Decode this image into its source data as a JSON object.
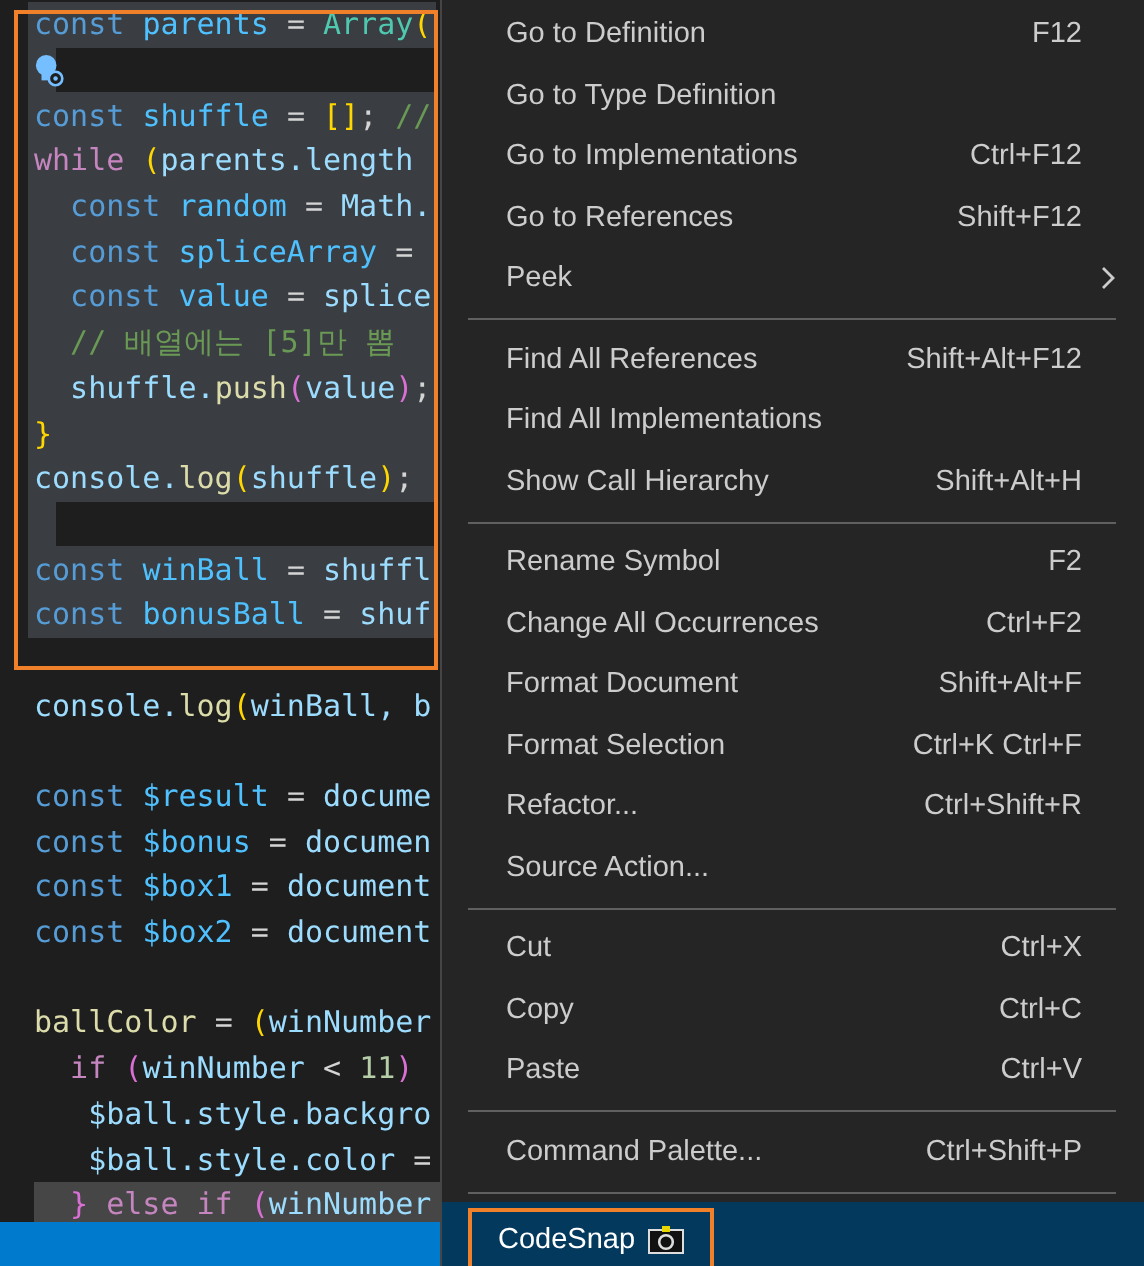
{
  "editor": {
    "outlined": true,
    "lines": [
      {
        "selected": true,
        "tokens": [
          {
            "kind": "kw",
            "text": "const "
          },
          {
            "kind": "const",
            "text": "parents "
          },
          {
            "kind": "op",
            "text": "= "
          },
          {
            "kind": "type",
            "text": "Array"
          },
          {
            "kind": "b1",
            "text": "("
          }
        ]
      },
      {
        "selected": true,
        "lightbulb": true
      },
      {
        "selected": true,
        "tokens": [
          {
            "kind": "kw",
            "text": "const "
          },
          {
            "kind": "const",
            "text": "shuffle "
          },
          {
            "kind": "op",
            "text": "= "
          },
          {
            "kind": "b1",
            "text": "[]"
          },
          {
            "kind": "op",
            "text": "; "
          },
          {
            "kind": "comment",
            "text": "//"
          }
        ]
      },
      {
        "selected": true,
        "tokens": [
          {
            "kind": "ctrl",
            "text": "while "
          },
          {
            "kind": "b1",
            "text": "("
          },
          {
            "kind": "var",
            "text": "parents.length"
          }
        ]
      },
      {
        "selected": true,
        "tokens": [
          {
            "kind": "kw",
            "text": "  const "
          },
          {
            "kind": "const",
            "text": "random "
          },
          {
            "kind": "op",
            "text": "= "
          },
          {
            "kind": "var",
            "text": "Math."
          }
        ]
      },
      {
        "selected": true,
        "tokens": [
          {
            "kind": "kw",
            "text": "  const "
          },
          {
            "kind": "const",
            "text": "spliceArray "
          },
          {
            "kind": "op",
            "text": "="
          }
        ]
      },
      {
        "selected": true,
        "tokens": [
          {
            "kind": "kw",
            "text": "  const "
          },
          {
            "kind": "const",
            "text": "value "
          },
          {
            "kind": "op",
            "text": "= "
          },
          {
            "kind": "var",
            "text": "splice"
          }
        ]
      },
      {
        "selected": true,
        "tokens": [
          {
            "kind": "comment",
            "text": "  // 배열에는 [5]만 뽑"
          }
        ]
      },
      {
        "selected": true,
        "tokens": [
          {
            "kind": "var",
            "text": "  shuffle."
          },
          {
            "kind": "func",
            "text": "push"
          },
          {
            "kind": "b2",
            "text": "("
          },
          {
            "kind": "var",
            "text": "value"
          },
          {
            "kind": "b2",
            "text": ")"
          },
          {
            "kind": "op",
            "text": ";"
          }
        ]
      },
      {
        "selected": true,
        "tokens": [
          {
            "kind": "b1",
            "text": "}"
          }
        ]
      },
      {
        "selected": true,
        "tokens": [
          {
            "kind": "var",
            "text": "console."
          },
          {
            "kind": "func",
            "text": "log"
          },
          {
            "kind": "b1",
            "text": "("
          },
          {
            "kind": "var",
            "text": "shuffle"
          },
          {
            "kind": "b1",
            "text": ")"
          },
          {
            "kind": "op",
            "text": ";"
          }
        ]
      },
      {
        "selected": true
      },
      {
        "selected": true,
        "tokens": [
          {
            "kind": "kw",
            "text": "const "
          },
          {
            "kind": "const",
            "text": "winBall "
          },
          {
            "kind": "op",
            "text": "= "
          },
          {
            "kind": "var",
            "text": "shuffl"
          }
        ]
      },
      {
        "selected": true,
        "tokens": [
          {
            "kind": "kw",
            "text": "const "
          },
          {
            "kind": "const",
            "text": "bonusBall "
          },
          {
            "kind": "op",
            "text": "= "
          },
          {
            "kind": "var",
            "text": "shuf"
          }
        ]
      },
      {
        "selected": false
      },
      {
        "selected": false,
        "tokens": [
          {
            "kind": "var",
            "text": "console."
          },
          {
            "kind": "func",
            "text": "log"
          },
          {
            "kind": "b1",
            "text": "("
          },
          {
            "kind": "var",
            "text": "winBall, b"
          }
        ]
      },
      {
        "selected": false
      },
      {
        "selected": false,
        "tokens": [
          {
            "kind": "kw",
            "text": "const "
          },
          {
            "kind": "const",
            "text": "$result "
          },
          {
            "kind": "op",
            "text": "= "
          },
          {
            "kind": "var",
            "text": "docume"
          }
        ]
      },
      {
        "selected": false,
        "tokens": [
          {
            "kind": "kw",
            "text": "const "
          },
          {
            "kind": "const",
            "text": "$bonus "
          },
          {
            "kind": "op",
            "text": "= "
          },
          {
            "kind": "var",
            "text": "documen"
          }
        ]
      },
      {
        "selected": false,
        "tokens": [
          {
            "kind": "kw",
            "text": "const "
          },
          {
            "kind": "const",
            "text": "$box1 "
          },
          {
            "kind": "op",
            "text": "= "
          },
          {
            "kind": "var",
            "text": "document"
          }
        ]
      },
      {
        "selected": false,
        "tokens": [
          {
            "kind": "kw",
            "text": "const "
          },
          {
            "kind": "const",
            "text": "$box2 "
          },
          {
            "kind": "op",
            "text": "= "
          },
          {
            "kind": "var",
            "text": "document"
          }
        ]
      },
      {
        "selected": false
      },
      {
        "selected": false,
        "tokens": [
          {
            "kind": "func",
            "text": "ballColor "
          },
          {
            "kind": "op",
            "text": "= "
          },
          {
            "kind": "b1",
            "text": "("
          },
          {
            "kind": "var",
            "text": "winNumber"
          }
        ]
      },
      {
        "selected": false,
        "tokens": [
          {
            "kind": "ctrl",
            "text": "  if "
          },
          {
            "kind": "b2",
            "text": "("
          },
          {
            "kind": "var",
            "text": "winNumber "
          },
          {
            "kind": "op",
            "text": "< "
          },
          {
            "kind": "num",
            "text": "11"
          },
          {
            "kind": "b2",
            "text": ")"
          }
        ]
      },
      {
        "selected": false,
        "tokens": [
          {
            "kind": "var",
            "text": "   $ball.style.backgro"
          }
        ]
      },
      {
        "selected": false,
        "tokens": [
          {
            "kind": "var",
            "text": "   $ball.style.color "
          },
          {
            "kind": "op",
            "text": "="
          }
        ]
      },
      {
        "selected": false,
        "current": true,
        "tokens": [
          {
            "kind": "b2",
            "text": "  } "
          },
          {
            "kind": "ctrl",
            "text": "else if "
          },
          {
            "kind": "b2",
            "text": "("
          },
          {
            "kind": "var",
            "text": "winNumber"
          }
        ]
      }
    ]
  },
  "context_menu": {
    "groups": [
      [
        {
          "label": "Go to Definition",
          "shortcut": "F12"
        },
        {
          "label": "Go to Type Definition"
        },
        {
          "label": "Go to Implementations",
          "shortcut": "Ctrl+F12"
        },
        {
          "label": "Go to References",
          "shortcut": "Shift+F12"
        },
        {
          "label": "Peek",
          "submenu": true
        }
      ],
      [
        {
          "label": "Find All References",
          "shortcut": "Shift+Alt+F12"
        },
        {
          "label": "Find All Implementations"
        },
        {
          "label": "Show Call Hierarchy",
          "shortcut": "Shift+Alt+H"
        }
      ],
      [
        {
          "label": "Rename Symbol",
          "shortcut": "F2"
        },
        {
          "label": "Change All Occurrences",
          "shortcut": "Ctrl+F2"
        },
        {
          "label": "Format Document",
          "shortcut": "Shift+Alt+F"
        },
        {
          "label": "Format Selection",
          "shortcut": "Ctrl+K Ctrl+F"
        },
        {
          "label": "Refactor...",
          "shortcut": "Ctrl+Shift+R"
        },
        {
          "label": "Source Action..."
        }
      ],
      [
        {
          "label": "Cut",
          "shortcut": "Ctrl+X"
        },
        {
          "label": "Copy",
          "shortcut": "Ctrl+C"
        },
        {
          "label": "Paste",
          "shortcut": "Ctrl+V"
        }
      ],
      [
        {
          "label": "Command Palette...",
          "shortcut": "Ctrl+Shift+P"
        }
      ],
      [
        {
          "label": "CodeSnap",
          "camera": true,
          "selected": true,
          "outlined": true
        }
      ]
    ]
  }
}
